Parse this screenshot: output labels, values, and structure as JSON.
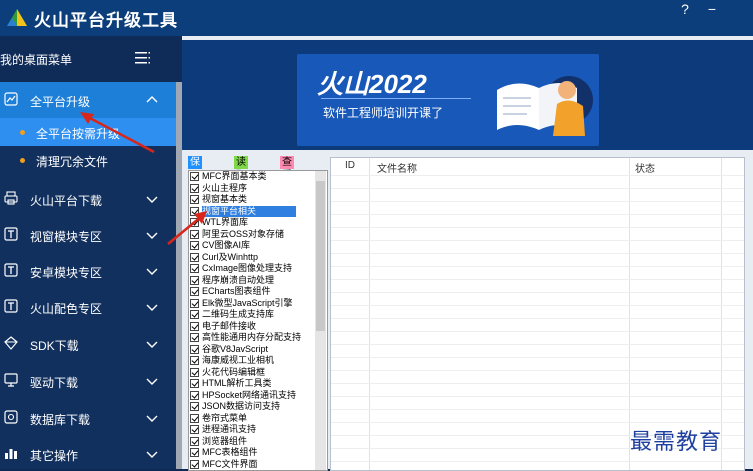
{
  "window": {
    "title": "火山平台升级工具",
    "help_label": "?",
    "minimize_label": "−"
  },
  "sidebar": {
    "header_label": "我的桌面菜单",
    "items": [
      {
        "label": "全平台升级",
        "icon": "chart-icon",
        "expanded": true
      },
      {
        "label": "火山平台下载",
        "icon": "printer-icon"
      },
      {
        "label": "视窗模块专区",
        "icon": "t-box-icon"
      },
      {
        "label": "安卓模块专区",
        "icon": "t-box-icon"
      },
      {
        "label": "火山配色专区",
        "icon": "t-box-icon"
      },
      {
        "label": "SDK下载",
        "icon": "diamond-icon"
      },
      {
        "label": "驱动下载",
        "icon": "monitor-icon"
      },
      {
        "label": "数据库下载",
        "icon": "database-icon"
      },
      {
        "label": "其它操作",
        "icon": "bars-icon"
      }
    ],
    "subitems": [
      {
        "label": "全平台按需升级",
        "active": true
      },
      {
        "label": "清理冗余文件",
        "active": false
      }
    ]
  },
  "banner": {
    "title": "火山2022",
    "subtitle": "软件工程师培训开课了",
    "slide_count": 4,
    "active_slide": 1
  },
  "toolbar": {
    "save_config": "保存配置",
    "read_config": "读取配置",
    "check_update": "查看更新"
  },
  "modules": [
    "MFC界面基本类",
    "火山主程序",
    "视窗基本类",
    "视窗平台相关",
    "WTL界面库",
    "阿里云OSS对象存储",
    "CV图像AI库",
    "Curl及Winhttp",
    "CxImage图像处理支持",
    "程序崩溃自动处理",
    "ECharts图表组件",
    "Elk微型JavaScript引擎",
    "二维码生成支持库",
    "电子邮件接收",
    "高性能通用内存分配支持",
    "谷歌V8JavScript",
    "海康威视工业相机",
    "火花代码编辑框",
    "HTML解析工具类",
    "HPSocket网络通讯支持",
    "JSON数据访问支持",
    "卷帘式菜单",
    "进程通讯支持",
    "浏览器组件",
    "MFC表格组件",
    "MFC文件界面"
  ],
  "selected_module_index": 3,
  "file_table": {
    "columns": [
      "ID",
      "文件名称",
      "状态"
    ]
  },
  "watermark": "最需教育",
  "colors": {
    "titlebar": "#0b3e7a",
    "sidebar": "#12305e",
    "accent": "#1e7fd8",
    "btn_save": "#1e90ff",
    "btn_read": "#7fd84a",
    "btn_update": "#ff8ab0",
    "arrow": "#d9261c"
  }
}
